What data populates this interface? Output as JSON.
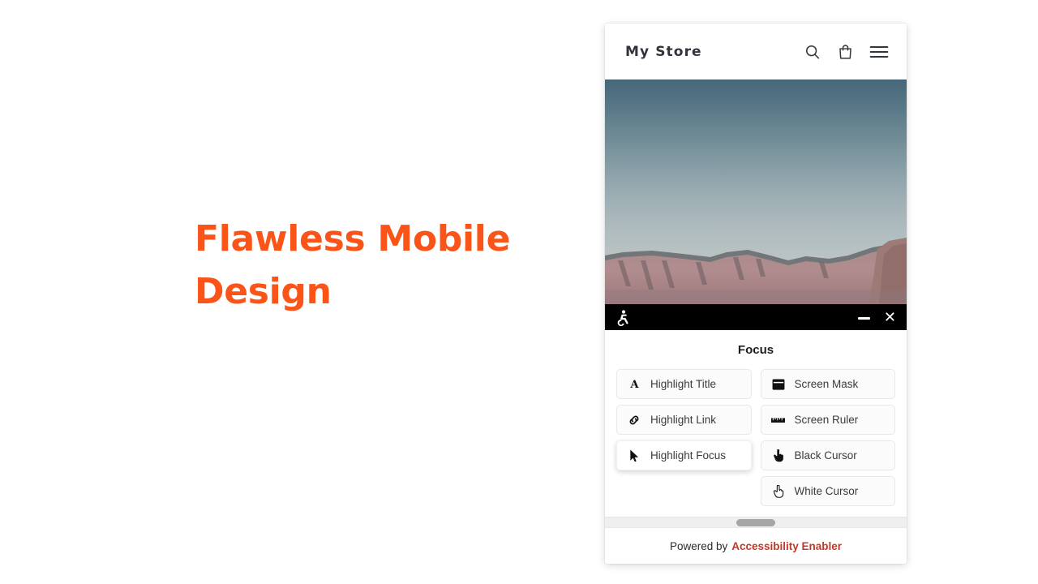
{
  "promo": {
    "headline": "Flawless Mobile Design",
    "headline_color": "#fa5419"
  },
  "store": {
    "title": "My Store",
    "header_icons": [
      {
        "name": "search-icon",
        "label": "Search"
      },
      {
        "name": "shopping-bag-icon",
        "label": "Cart"
      },
      {
        "name": "hamburger-menu-icon",
        "label": "Menu"
      }
    ],
    "hero_alt": "Canyon landscape at dusk"
  },
  "accessibility_widget": {
    "logo_icon": "accessibility-person-icon",
    "minimize_label": "Minimize",
    "close_label": "Close",
    "section_title": "Focus",
    "options_left": [
      {
        "icon": "letter-a-icon",
        "label": "Highlight Title",
        "hovered": false
      },
      {
        "icon": "link-chain-icon",
        "label": "Highlight Link",
        "hovered": false
      },
      {
        "icon": "mouse-pointer-icon",
        "label": "Highlight Focus",
        "hovered": true
      }
    ],
    "options_right": [
      {
        "icon": "screen-mask-icon",
        "label": "Screen Mask",
        "hovered": false
      },
      {
        "icon": "ruler-icon",
        "label": "Screen Ruler",
        "hovered": false
      },
      {
        "icon": "black-cursor-icon",
        "label": "Black Cursor",
        "hovered": false
      },
      {
        "icon": "white-cursor-icon",
        "label": "White Cursor",
        "hovered": false
      }
    ],
    "footer": {
      "prefix": "Powered by",
      "brand": "Accessibility Enabler",
      "brand_color": "#c0392b"
    }
  }
}
